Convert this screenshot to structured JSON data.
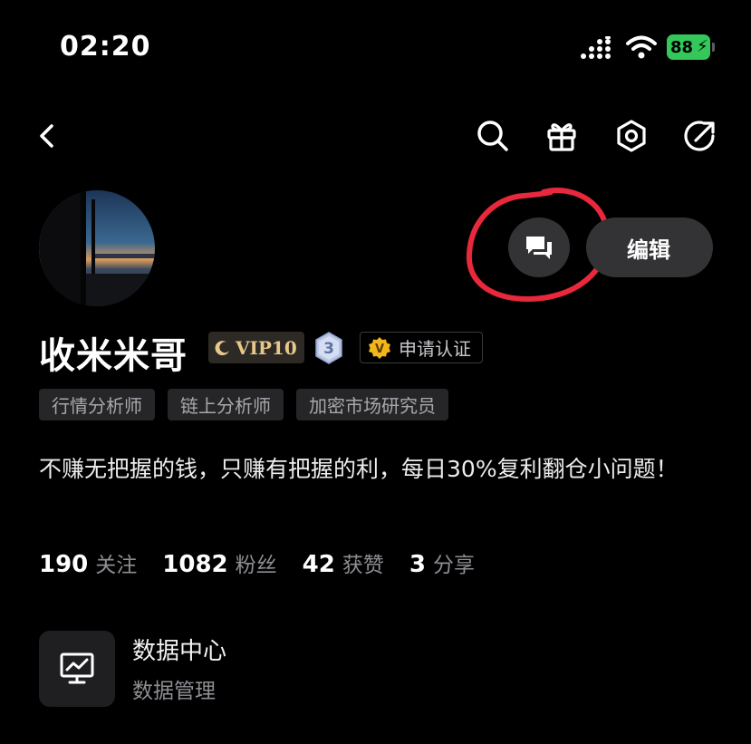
{
  "status_bar": {
    "time": "02:20",
    "battery_level": "88"
  },
  "nav": {
    "icons": [
      "back-chevron-icon",
      "search-icon",
      "gift-icon",
      "settings-icon",
      "share-icon"
    ]
  },
  "profile": {
    "name": "收米米哥",
    "vip_label": "VIP10",
    "level": "3",
    "verify_label": "申请认证",
    "verify_icon_letter": "V",
    "tags": [
      "行情分析师",
      "链上分析师",
      "加密市场研究员"
    ],
    "bio": "不赚无把握的钱，只赚有把握的利，每日30%复利翻仓小问题！",
    "edit_label": "编辑"
  },
  "stats": [
    {
      "value": "190",
      "label": "关注"
    },
    {
      "value": "1082",
      "label": "粉丝"
    },
    {
      "value": "42",
      "label": "获赞"
    },
    {
      "value": "3",
      "label": "分享"
    }
  ],
  "data_center": {
    "title": "数据中心",
    "subtitle": "数据管理"
  },
  "colors": {
    "background": "#000000",
    "button_bg": "#333336",
    "vip_gold": "#e8c88a",
    "battery_green": "#34c759",
    "annotation_red": "#e8283c"
  }
}
